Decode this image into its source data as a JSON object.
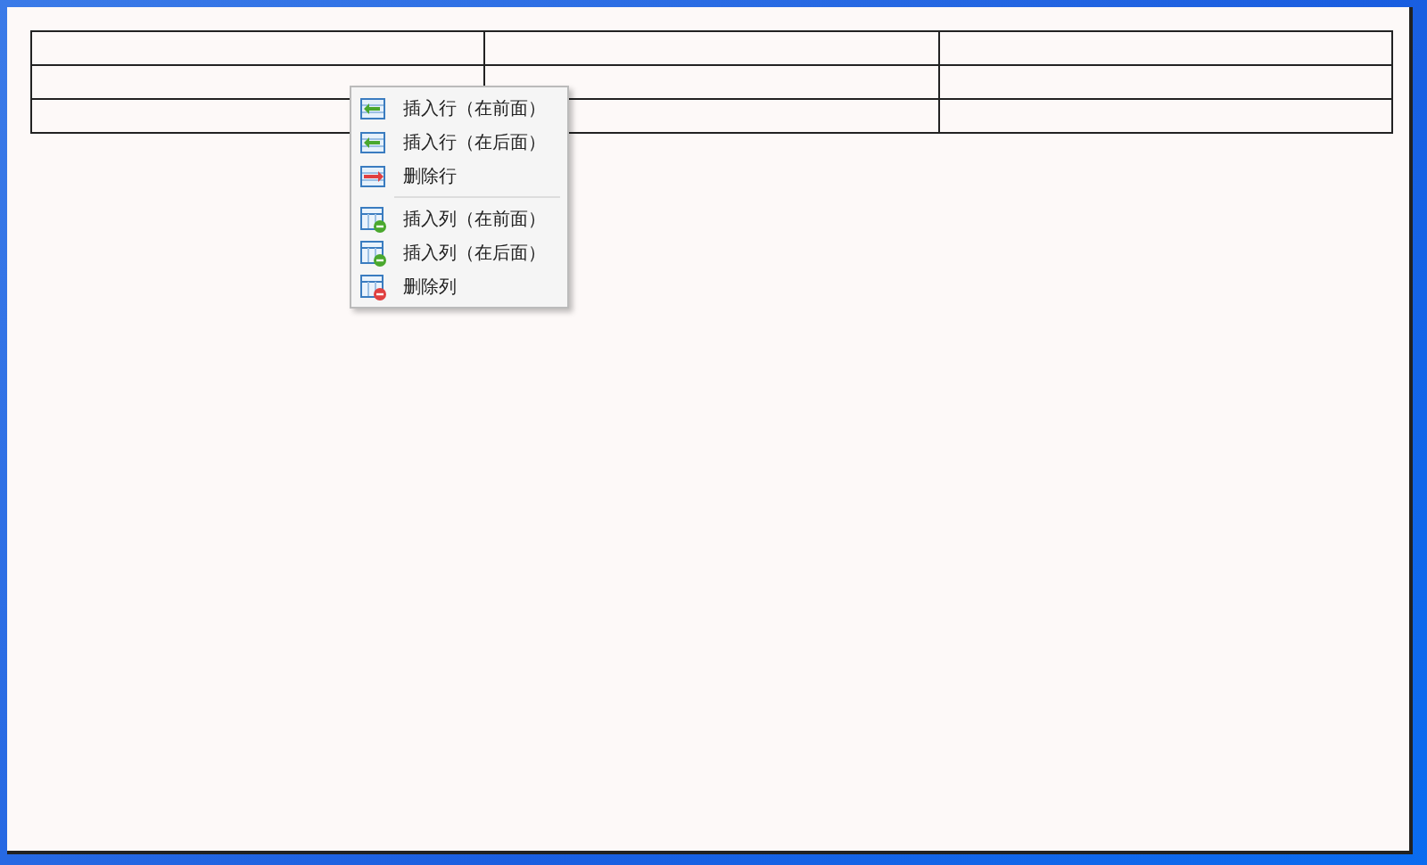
{
  "table": {
    "rows": [
      {
        "cells": [
          {},
          {},
          {}
        ]
      },
      {
        "cells": [
          {},
          {},
          {}
        ]
      },
      {
        "cells": [
          {},
          {},
          {}
        ]
      }
    ]
  },
  "context_menu": {
    "groups": [
      {
        "items": [
          {
            "label": "插入行（在前面）",
            "kind": "insert-row"
          },
          {
            "label": "插入行（在后面）",
            "kind": "insert-row"
          },
          {
            "label": "删除行",
            "kind": "delete-row"
          }
        ]
      },
      {
        "items": [
          {
            "label": "插入列（在前面）",
            "kind": "insert-column"
          },
          {
            "label": "插入列（在后面）",
            "kind": "insert-column"
          },
          {
            "label": "删除列",
            "kind": "delete-column"
          }
        ]
      }
    ]
  }
}
